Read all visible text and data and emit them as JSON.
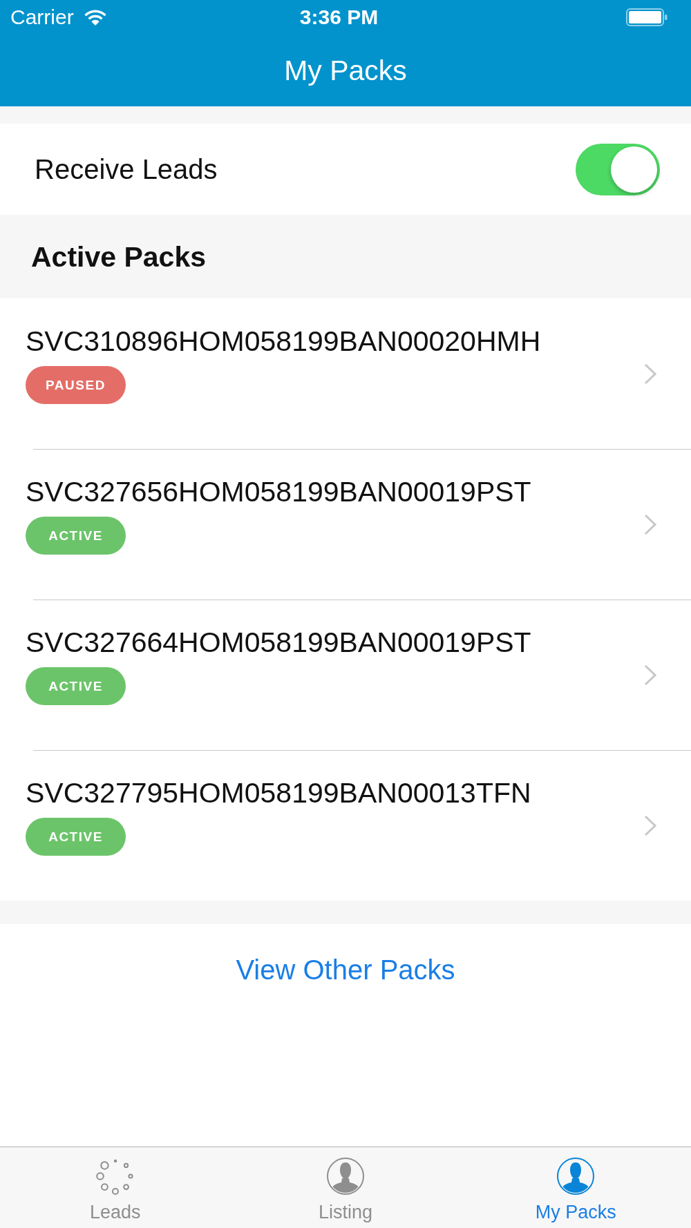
{
  "status_bar": {
    "carrier": "Carrier",
    "time": "3:36 PM"
  },
  "nav_bar": {
    "title": "My Packs"
  },
  "receive_leads": {
    "label": "Receive Leads",
    "on": true
  },
  "active_packs": {
    "heading": "Active Packs",
    "items": [
      {
        "code": "SVC310896HOM058199BAN00020HMH",
        "status": {
          "label": "PAUSED",
          "color": "#e46e67"
        }
      },
      {
        "code": "SVC327656HOM058199BAN00019PST",
        "status": {
          "label": "ACTIVE",
          "color": "#6cc46a"
        }
      },
      {
        "code": "SVC327664HOM058199BAN00019PST",
        "status": {
          "label": "ACTIVE",
          "color": "#6cc46a"
        }
      },
      {
        "code": "SVC327795HOM058199BAN00013TFN",
        "status": {
          "label": "ACTIVE",
          "color": "#6cc46a"
        }
      }
    ]
  },
  "view_other_packs": {
    "label": "View Other Packs"
  },
  "tab_bar": [
    {
      "label": "Leads",
      "kind": "dots",
      "selected": false
    },
    {
      "label": "Listing",
      "kind": "person",
      "selected": false
    },
    {
      "label": "My Packs",
      "kind": "person",
      "selected": true
    }
  ]
}
